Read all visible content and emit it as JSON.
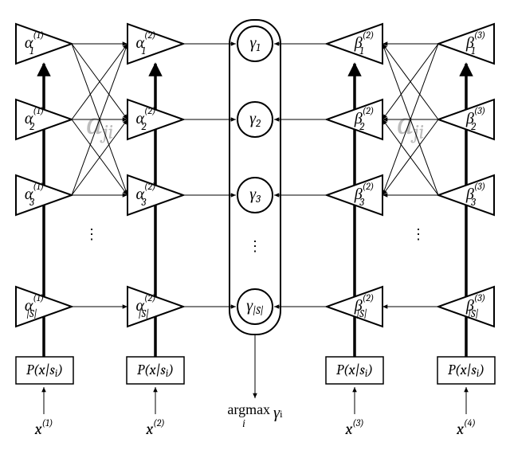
{
  "chart_data": {
    "type": "diagram",
    "description": "Forward-backward (BCJR) trellis network with alpha, beta, gamma nodes, emission blocks P(x|s_i), inputs x^(t), argmax over gamma_i.",
    "columns": [
      {
        "name": "alpha1",
        "type": "alpha-right",
        "superscript": "1",
        "x_label": "x^(1)"
      },
      {
        "name": "alpha2",
        "type": "alpha-right",
        "superscript": "2",
        "x_label": "x^(2)"
      },
      {
        "name": "gamma",
        "type": "gamma",
        "argmax": true
      },
      {
        "name": "beta2",
        "type": "beta-left",
        "superscript": "2",
        "x_label": "x^(3)"
      },
      {
        "name": "beta3",
        "type": "beta-left",
        "superscript": "3",
        "x_label": "x^(4)"
      }
    ],
    "state_indices": [
      "1",
      "2",
      "3",
      "|S|"
    ],
    "emission_label": "P(x|s_i)",
    "transition_label": "a_ji",
    "argmax_label": "argmax_i γ_i"
  },
  "labels": {
    "alpha": "α",
    "beta": "β",
    "gamma": "γ",
    "sup1": "(1)",
    "sup2": "(2)",
    "sup3": "(3)",
    "sub1": "1",
    "sub2": "2",
    "sub3": "3",
    "subS": "|S|",
    "pxsi": "P(x|s",
    "pxsi2": ")",
    "x": "x",
    "xsup1": "(1)",
    "xsup2": "(2)",
    "xsup3": "(3)",
    "xsup4": "(4)",
    "aji": "a",
    "aji_sub": "ji",
    "argmax": "argmax",
    "argmax_i": "i",
    "argmax_g": "γ",
    "argmax_gi": "i"
  }
}
